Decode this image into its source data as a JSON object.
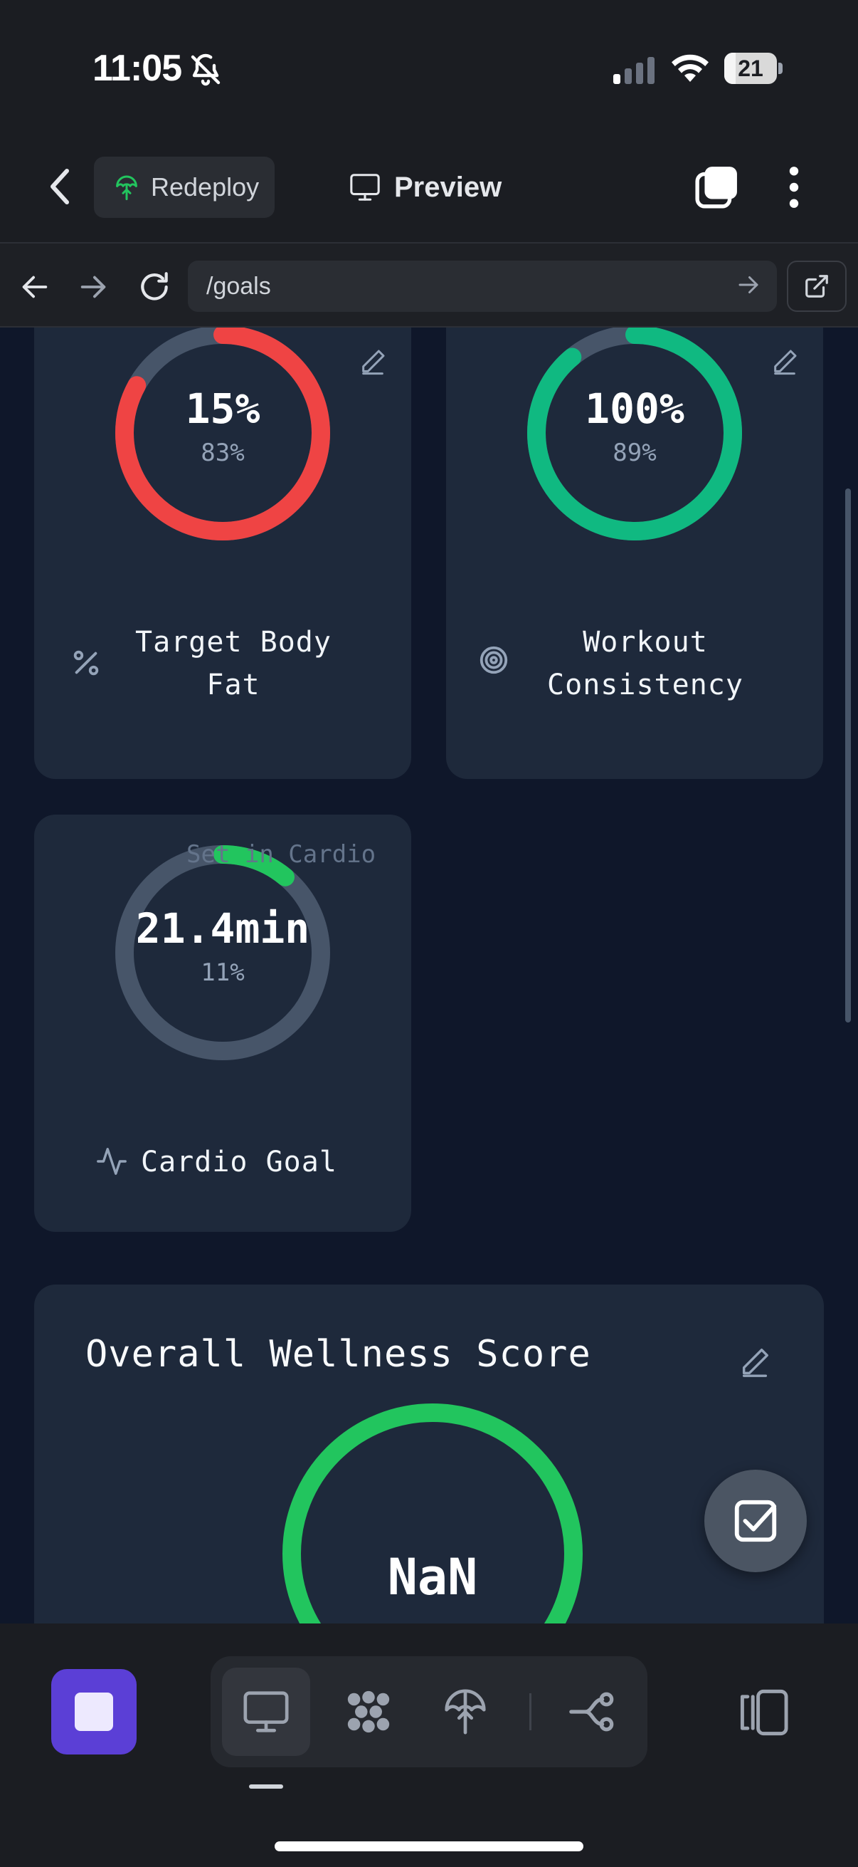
{
  "status_bar": {
    "time": "11:05",
    "battery": "21",
    "battery_level": 0.21
  },
  "app_bar": {
    "redeploy_label": "Redeploy",
    "preview_label": "Preview"
  },
  "browser": {
    "url": "/goals"
  },
  "colors": {
    "red": "#ef4444",
    "teal": "#10b981",
    "green": "#22c55e",
    "track": "#475569",
    "accent": "#5b3fd6"
  },
  "goals": [
    {
      "value": "15%",
      "percent_label": "83%",
      "progress": 0.83,
      "color": "#ef4444",
      "title_line1": "Target Body",
      "title_line2": "Fat",
      "icon": "percent-icon"
    },
    {
      "value": "100%",
      "percent_label": "89%",
      "progress": 0.89,
      "color": "#10b981",
      "title_line1": "Workout",
      "title_line2": "Consistency",
      "icon": "target-icon"
    },
    {
      "value": "21.4min",
      "percent_label": "11%",
      "progress": 0.11,
      "color": "#22c55e",
      "title": "Cardio Goal",
      "note": "Set in Cardio",
      "icon": "activity-icon"
    }
  ],
  "wellness": {
    "title": "Overall Wellness Score",
    "value": "NaN"
  }
}
